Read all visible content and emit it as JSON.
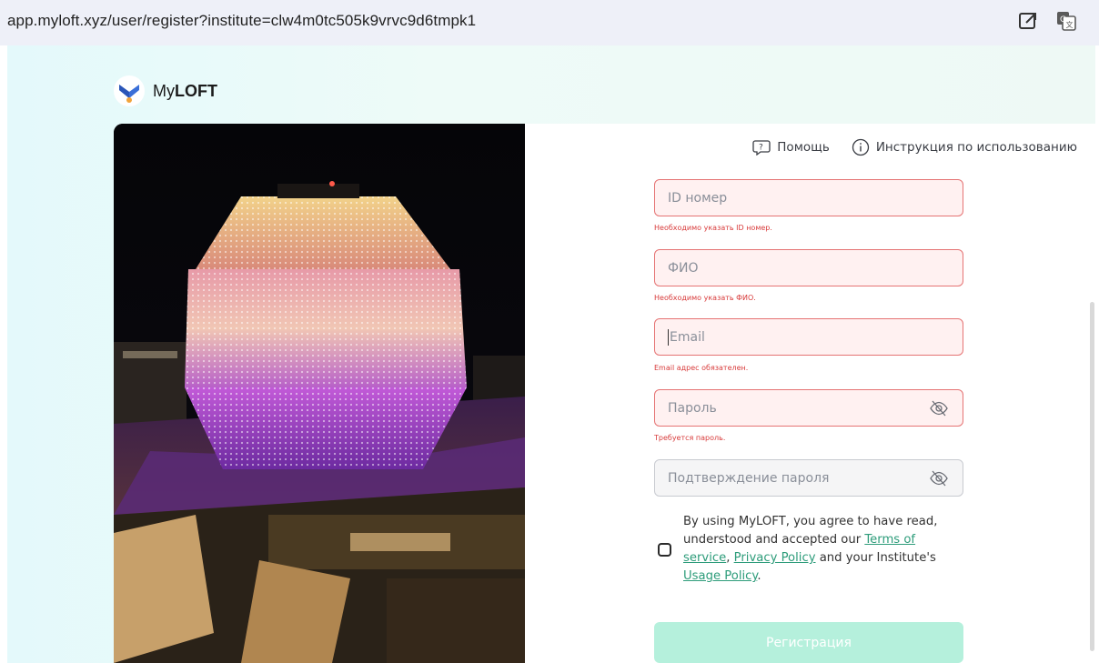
{
  "browser": {
    "url": "app.myloft.xyz/user/register?institute=clw4m0tc505k9vrvc9d6tmpk1",
    "icons": [
      "open-in-new-window-icon",
      "translate-icon"
    ]
  },
  "brand": {
    "logo_prefix": "My",
    "logo_bold": "LOFT"
  },
  "header_links": {
    "help": "Помощь",
    "instructions": "Инструкция по использованию"
  },
  "form": {
    "id_field": {
      "placeholder": "ID номер",
      "error": "Необходимо указать ID номер."
    },
    "name_field": {
      "placeholder": "ФИО",
      "error": "Необходимо указать ФИО."
    },
    "email_field": {
      "placeholder": "Email",
      "error": "Email адрес обязателен."
    },
    "password_field": {
      "placeholder": "Пароль",
      "error": "Требуется пароль."
    },
    "confirm_field": {
      "placeholder": "Подтверждение пароля"
    },
    "consent": {
      "text_1": "By using MyLOFT, you agree to have read, understood and accepted our ",
      "terms_link": "Terms of service",
      "sep_1": ", ",
      "privacy_link": "Privacy Policy",
      "text_2": " and your Institute's ",
      "usage_link": "Usage Policy",
      "end": "."
    },
    "submit_label": "Регистрация"
  },
  "colors": {
    "accent": "#2d9c7a",
    "error": "#d83b3b",
    "error_field_bg": "#fff1f1",
    "submit_bg": "#b5f0dc"
  }
}
